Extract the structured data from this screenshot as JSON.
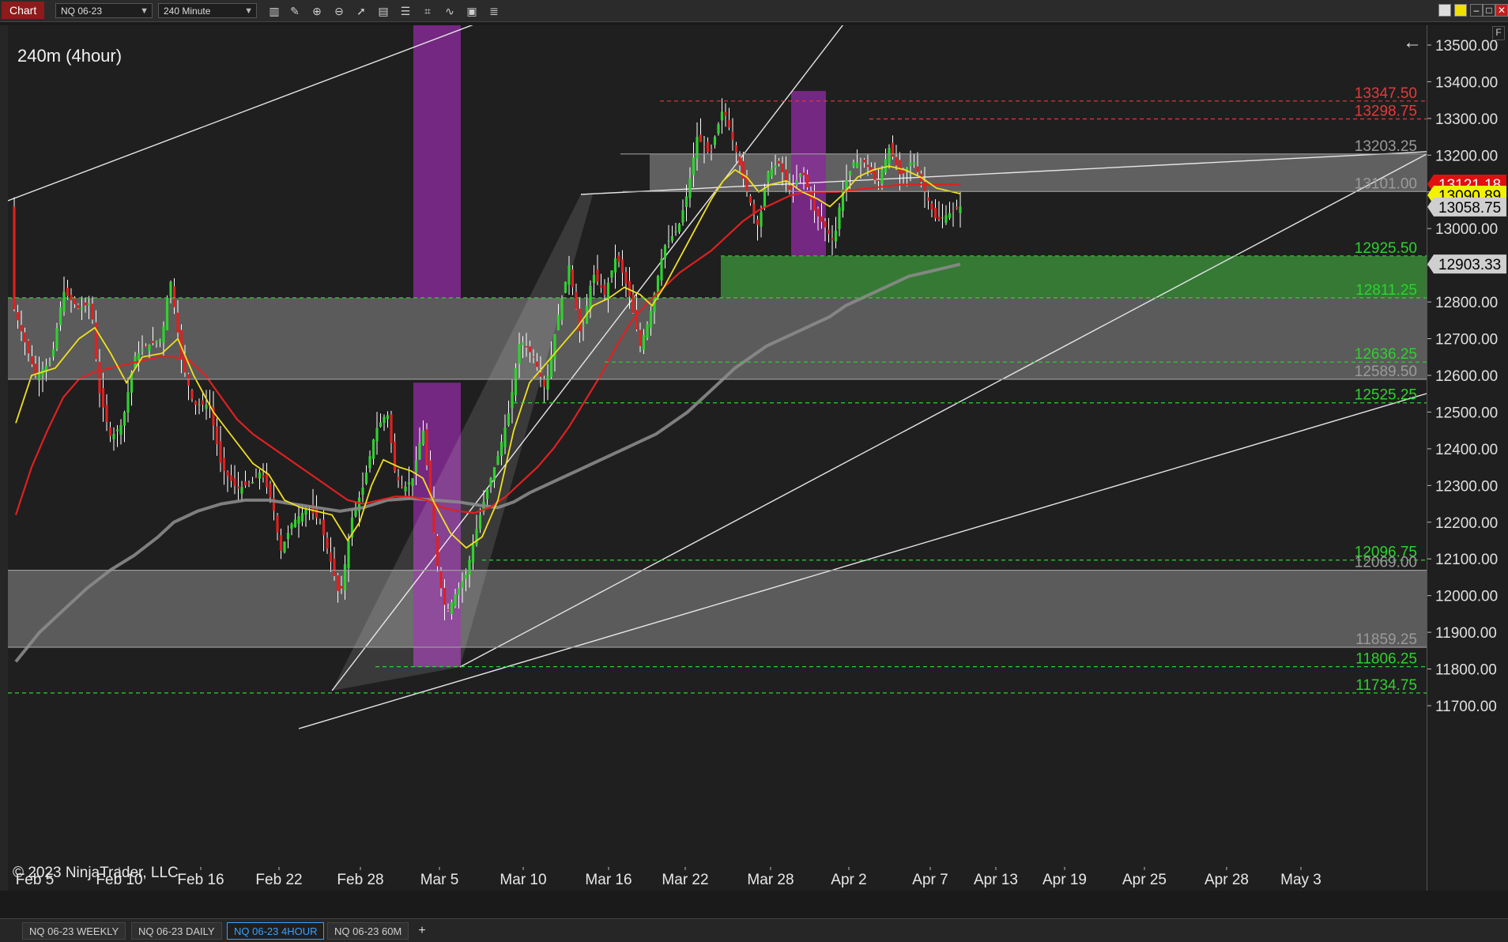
{
  "toolbar": {
    "chart_label": "Chart",
    "instrument": "NQ 06-23",
    "interval": "240 Minute",
    "icons": [
      "bar-type-icon",
      "draw-pencil-icon",
      "zoom-in-icon",
      "zoom-out-icon",
      "pointer-icon",
      "data-box-icon",
      "properties-icon",
      "strategies-icon",
      "indicators-icon",
      "templates-icon",
      "list-icon"
    ]
  },
  "chart": {
    "title": "240m (4hour)",
    "copyright": "© 2023 NinjaTrader, LLC",
    "f_button": "F"
  },
  "chart_data": {
    "type": "candlestick",
    "ylim": [
      11640,
      13580
    ],
    "y_ticks": [
      13500,
      13400,
      13300,
      13200,
      13100,
      13000,
      12900,
      12800,
      12700,
      12600,
      12500,
      12400,
      12300,
      12200,
      12100,
      12000,
      11900,
      11800,
      11700
    ],
    "y_tick_labels": [
      "13500.00",
      "13400.00",
      "13300.00",
      "13200.00",
      "13100.00",
      "13000.00",
      "12900.00",
      "12800.00",
      "12700.00",
      "12600.00",
      "12500.00",
      "12400.00",
      "12300.00",
      "12200.00",
      "12100.00",
      "12000.00",
      "11900.00",
      "11800.00",
      "11700.00"
    ],
    "x_labels": [
      "Feb 5",
      "Feb 10",
      "Feb 16",
      "Feb 22",
      "Feb 28",
      "Mar 5",
      "Mar 10",
      "Mar 16",
      "Mar 22",
      "Mar 28",
      "Apr 2",
      "Apr 7",
      "Apr 13",
      "Apr 19",
      "Apr 25",
      "Apr 28",
      "May 3"
    ],
    "price_tags": [
      {
        "value": "13121.18",
        "price": 13121.18,
        "bg": "#e01010",
        "fg": "#ffffff"
      },
      {
        "value": "13090.89",
        "price": 13090.89,
        "bg": "#f2f200",
        "fg": "#000000"
      },
      {
        "value": "13058.75",
        "price": 13058.75,
        "bg": "#cfcfcf",
        "fg": "#000000"
      },
      {
        "value": "12903.33",
        "price": 12903.33,
        "bg": "#cfcfcf",
        "fg": "#000000"
      }
    ],
    "levels": [
      {
        "label": "13347.50",
        "price": 13347.5,
        "color": "#e23b3b"
      },
      {
        "label": "13298.75",
        "price": 13298.75,
        "color": "#e23b3b"
      },
      {
        "label": "13203.25",
        "price": 13203.25,
        "color": "#9a9a9a"
      },
      {
        "label": "13101.00",
        "price": 13101.0,
        "color": "#9a9a9a"
      },
      {
        "label": "12925.50",
        "price": 12925.5,
        "color": "#2fd12f"
      },
      {
        "label": "12811.25",
        "price": 12811.25,
        "color": "#2fd12f"
      },
      {
        "label": "12636.25",
        "price": 12636.25,
        "color": "#2fd12f"
      },
      {
        "label": "12589.50",
        "price": 12589.5,
        "color": "#9a9a9a"
      },
      {
        "label": "12525.25",
        "price": 12525.25,
        "color": "#2fd12f"
      },
      {
        "label": "12096.75",
        "price": 12096.75,
        "color": "#2fd12f"
      },
      {
        "label": "12069.00",
        "price": 12069.0,
        "color": "#9a9a9a"
      },
      {
        "label": "11859.25",
        "price": 11859.25,
        "color": "#9a9a9a"
      },
      {
        "label": "11806.25",
        "price": 11806.25,
        "color": "#2fd12f"
      },
      {
        "label": "11734.75",
        "price": 11734.75,
        "color": "#2fd12f"
      }
    ],
    "series": [
      {
        "name": "",
        "color": "#f0e020"
      },
      {
        "name": "",
        "color": "#e02020"
      },
      {
        "name": "",
        "color": "#8a8a8a"
      }
    ],
    "colors": {
      "up": "#2fd12f",
      "down": "#e02020",
      "zone": "#8c8c8c",
      "demand": "#3a8a3a",
      "session": "#8a2a9a"
    }
  },
  "tabs": [
    "NQ 06-23 WEEKLY",
    "NQ 06-23 DAILY",
    "NQ 06-23 4HOUR",
    "NQ 06-23 60M"
  ],
  "active_tab": "NQ 06-23 4HOUR",
  "add_tab": "+"
}
